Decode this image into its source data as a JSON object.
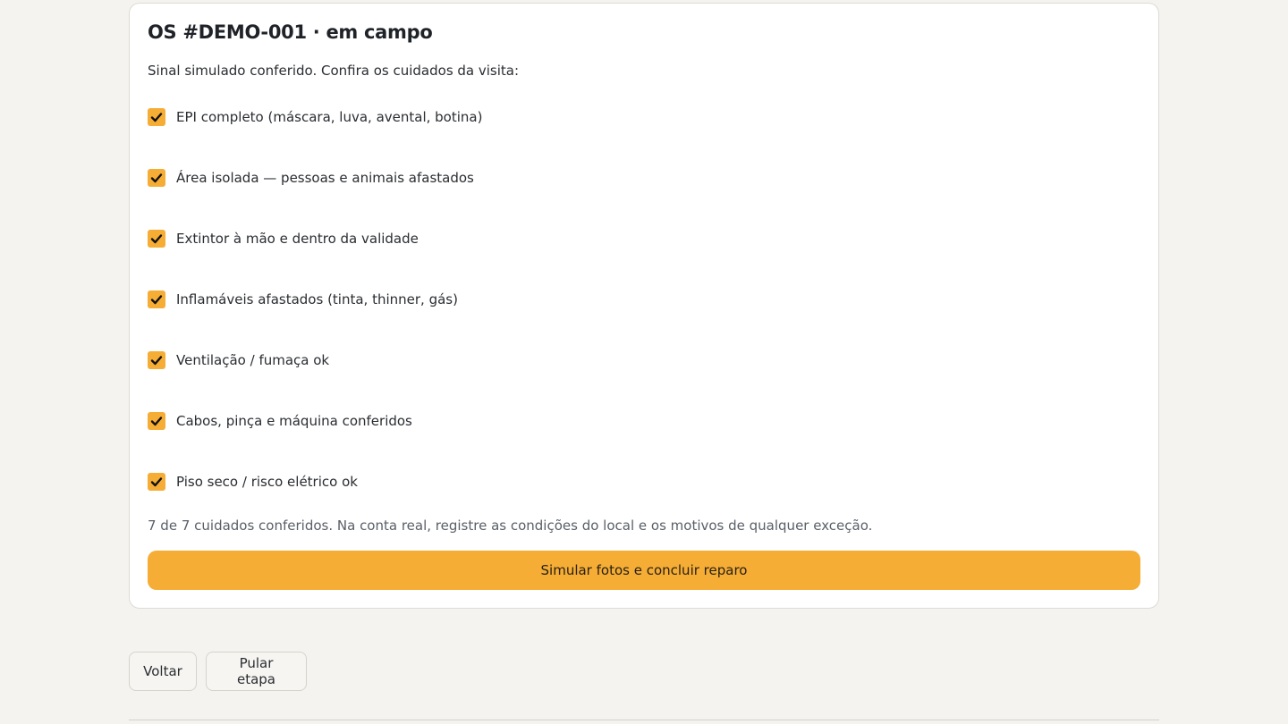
{
  "card": {
    "title": "OS #DEMO-001 · em campo",
    "intro": "Sinal simulado conferido. Confira os cuidados da visita:",
    "checklist": [
      {
        "label": "EPI completo (máscara, luva, avental, botina)",
        "checked": true
      },
      {
        "label": "Área isolada — pessoas e animais afastados",
        "checked": true
      },
      {
        "label": "Extintor à mão e dentro da validade",
        "checked": true
      },
      {
        "label": "Inflamáveis afastados (tinta, thinner, gás)",
        "checked": true
      },
      {
        "label": "Ventilação / fumaça ok",
        "checked": true
      },
      {
        "label": "Cabos, pinça e máquina conferidos",
        "checked": true
      },
      {
        "label": "Piso seco / risco elétrico ok",
        "checked": true
      }
    ],
    "summary": "7 de 7 cuidados conferidos. Na conta real, registre as condições do local e os motivos de qualquer exceção.",
    "primary_button": "Simular fotos e concluir reparo"
  },
  "nav": {
    "back_label": "Voltar",
    "skip_label": "Pular etapa"
  },
  "colors": {
    "accent": "#f5ad35",
    "background": "#f4f3ef",
    "card": "#ffffff"
  }
}
